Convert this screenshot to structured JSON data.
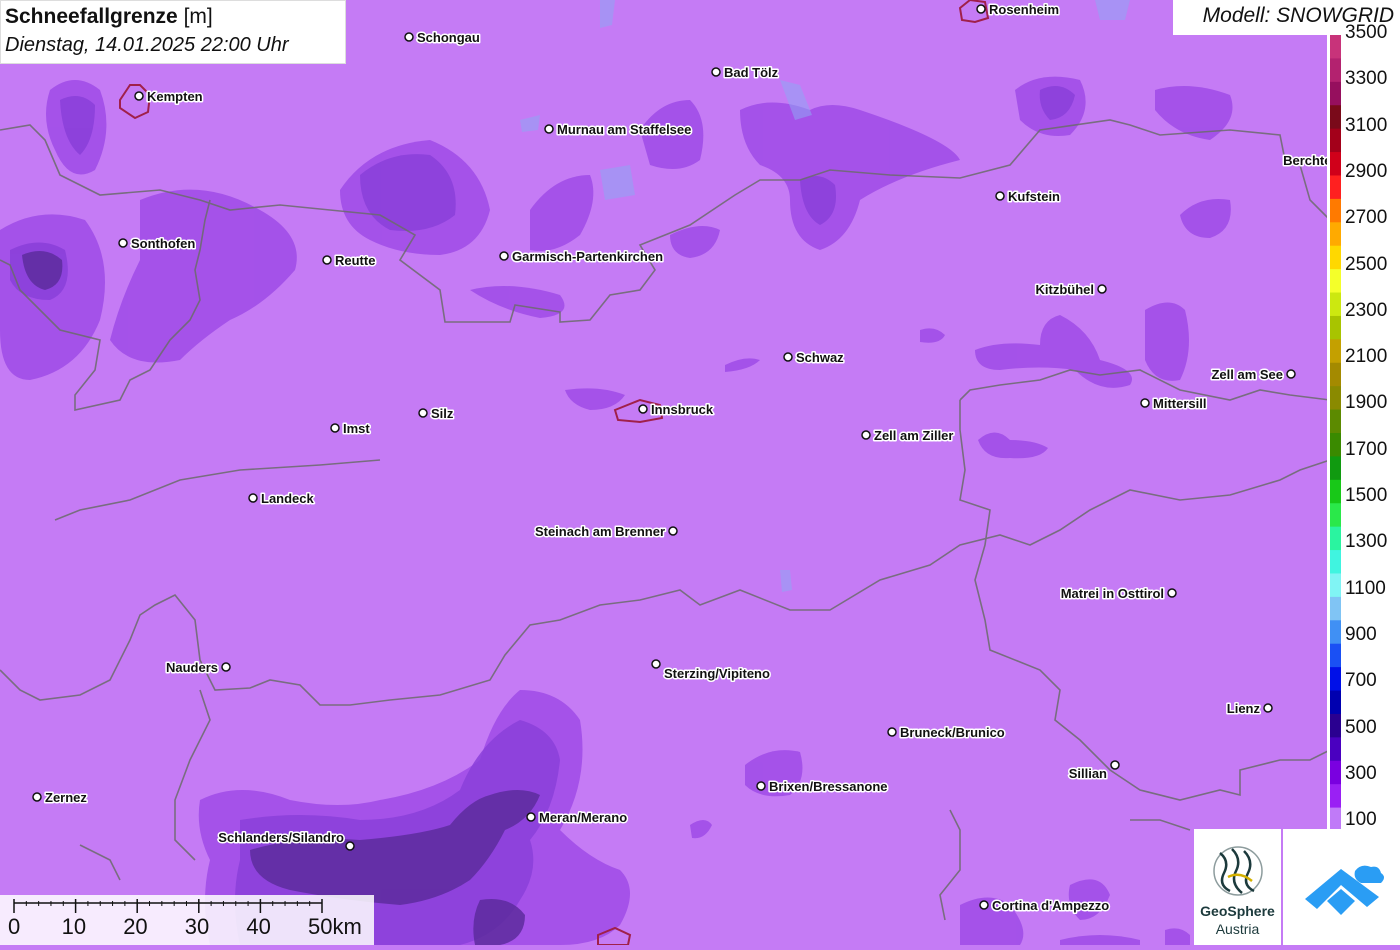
{
  "title": {
    "main": "Schneefallgrenze",
    "unit": "[m]",
    "datetime": "Dienstag, 14.01.2025 22:00 Uhr"
  },
  "model": "Modell: SNOWGRID",
  "legend": {
    "labels": [
      "3500",
      "3300",
      "3100",
      "2900",
      "2700",
      "2500",
      "2300",
      "2100",
      "1900",
      "1700",
      "1500",
      "1300",
      "1100",
      "900",
      "700",
      "500",
      "300",
      "100"
    ],
    "colors": [
      "#c8337a",
      "#b3226f",
      "#960f5e",
      "#7a0a1a",
      "#a3001a",
      "#d0001a",
      "#ff2020",
      "#ff7a00",
      "#ffaa00",
      "#ffd800",
      "#f4ff2a",
      "#cce810",
      "#a8c400",
      "#c4a000",
      "#a48a00",
      "#8a8a00",
      "#5c8a00",
      "#3a8a00",
      "#109a10",
      "#18c818",
      "#2ae84a",
      "#2af4a0",
      "#40f4e0",
      "#80f4f4",
      "#80c4f4",
      "#4090f4",
      "#1a50f4",
      "#0010e8",
      "#0000b0",
      "#2a0090",
      "#4a00c0",
      "#7a00e0",
      "#9a20f4",
      "#c07af8"
    ]
  },
  "cities": [
    {
      "name": "Rosenheim"
    },
    {
      "name": "Schongau"
    },
    {
      "name": "Bad Tölz"
    },
    {
      "name": "Kempten"
    },
    {
      "name": "Murnau am Staffelsee"
    },
    {
      "name": "Berchtesgaden"
    },
    {
      "name": "Kufstein"
    },
    {
      "name": "Sonthofen"
    },
    {
      "name": "Reutte"
    },
    {
      "name": "Garmisch-Partenkirchen"
    },
    {
      "name": "Kitzbühel"
    },
    {
      "name": "Schwaz"
    },
    {
      "name": "Zell am See"
    },
    {
      "name": "Innsbruck"
    },
    {
      "name": "Mittersill"
    },
    {
      "name": "Imst"
    },
    {
      "name": "Silz"
    },
    {
      "name": "Zell am Ziller"
    },
    {
      "name": "Landeck"
    },
    {
      "name": "Steinach am Brenner"
    },
    {
      "name": "Matrei in Osttirol"
    },
    {
      "name": "Nauders"
    },
    {
      "name": "Sterzing/Vipiteno"
    },
    {
      "name": "Lienz"
    },
    {
      "name": "Bruneck/Brunico"
    },
    {
      "name": "Sillian"
    },
    {
      "name": "Brixen/Bressanone"
    },
    {
      "name": "Zernez"
    },
    {
      "name": "Meran/Merano"
    },
    {
      "name": "Schlanders/Silandro"
    },
    {
      "name": "Cortina d'Ampezzo"
    }
  ],
  "scalebar": {
    "labels": [
      "0",
      "10",
      "20",
      "30",
      "40",
      "50km"
    ]
  },
  "logos": {
    "geosphere_line1": "GeoSphere",
    "geosphere_line2": "Austria"
  },
  "colors": {
    "map_base": "#c57bf5",
    "patch_light": "#a14ee8",
    "patch_mid": "#8a3fd9",
    "patch_dark": "#5a2a9a",
    "border": "#6b6b6b",
    "city_outline": "#a0204a",
    "snowgrid_blue": "#2a9df4"
  }
}
